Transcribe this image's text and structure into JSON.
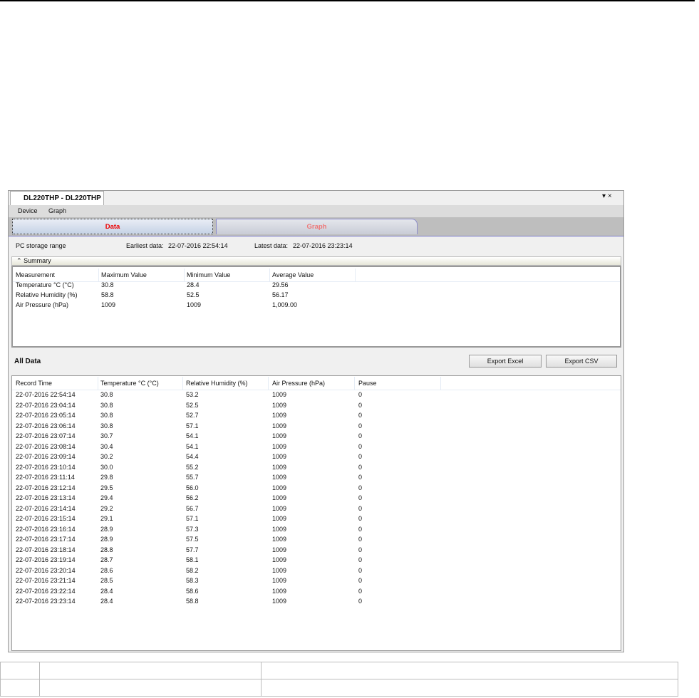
{
  "window": {
    "title": "DL220THP - DL220THP",
    "controls": [
      "▾",
      "×"
    ]
  },
  "menu": [
    "Device",
    "Graph"
  ],
  "tabs": [
    {
      "label": "Data",
      "active": true
    },
    {
      "label": "Graph",
      "active": false
    }
  ],
  "storage": {
    "label": "PC storage range",
    "earliest_label": "Earliest data:",
    "earliest": "22-07-2016 22:54:14",
    "latest_label": "Latest data:",
    "latest": "22-07-2016 23:23:14"
  },
  "summary": {
    "title": "Summary",
    "toggle_icon": "chevron-double-up",
    "columns": [
      "Measurement",
      "Maximum Value",
      "Minimum Value",
      "Average Value"
    ],
    "rows": [
      [
        "Temperature °C (°C)",
        "30.8",
        "28.4",
        "29.56"
      ],
      [
        "Relative Humidity (%)",
        "58.8",
        "52.5",
        "56.17"
      ],
      [
        "Air Pressure (hPa)",
        "1009",
        "1009",
        "1,009.00"
      ]
    ]
  },
  "all_data": {
    "title": "All Data",
    "export_excel": "Export Excel",
    "export_csv": "Export CSV",
    "columns": [
      "Record Time",
      "Temperature °C (°C)",
      "Relative Humidity (%)",
      "Air Pressure (hPa)",
      "Pause"
    ],
    "rows": [
      [
        "22-07-2016 22:54:14",
        "30.8",
        "53.2",
        "1009",
        "0"
      ],
      [
        "22-07-2016 23:04:14",
        "30.8",
        "52.5",
        "1009",
        "0"
      ],
      [
        "22-07-2016 23:05:14",
        "30.8",
        "52.7",
        "1009",
        "0"
      ],
      [
        "22-07-2016 23:06:14",
        "30.8",
        "57.1",
        "1009",
        "0"
      ],
      [
        "22-07-2016 23:07:14",
        "30.7",
        "54.1",
        "1009",
        "0"
      ],
      [
        "22-07-2016 23:08:14",
        "30.4",
        "54.1",
        "1009",
        "0"
      ],
      [
        "22-07-2016 23:09:14",
        "30.2",
        "54.4",
        "1009",
        "0"
      ],
      [
        "22-07-2016 23:10:14",
        "30.0",
        "55.2",
        "1009",
        "0"
      ],
      [
        "22-07-2016 23:11:14",
        "29.8",
        "55.7",
        "1009",
        "0"
      ],
      [
        "22-07-2016 23:12:14",
        "29.5",
        "56.0",
        "1009",
        "0"
      ],
      [
        "22-07-2016 23:13:14",
        "29.4",
        "56.2",
        "1009",
        "0"
      ],
      [
        "22-07-2016 23:14:14",
        "29.2",
        "56.7",
        "1009",
        "0"
      ],
      [
        "22-07-2016 23:15:14",
        "29.1",
        "57.1",
        "1009",
        "0"
      ],
      [
        "22-07-2016 23:16:14",
        "28.9",
        "57.3",
        "1009",
        "0"
      ],
      [
        "22-07-2016 23:17:14",
        "28.9",
        "57.5",
        "1009",
        "0"
      ],
      [
        "22-07-2016 23:18:14",
        "28.8",
        "57.7",
        "1009",
        "0"
      ],
      [
        "22-07-2016 23:19:14",
        "28.7",
        "58.1",
        "1009",
        "0"
      ],
      [
        "22-07-2016 23:20:14",
        "28.6",
        "58.2",
        "1009",
        "0"
      ],
      [
        "22-07-2016 23:21:14",
        "28.5",
        "58.3",
        "1009",
        "0"
      ],
      [
        "22-07-2016 23:22:14",
        "28.4",
        "58.6",
        "1009",
        "0"
      ],
      [
        "22-07-2016 23:23:14",
        "28.4",
        "58.8",
        "1009",
        "0"
      ]
    ]
  },
  "colors": {
    "active_tab_text": "#e00000",
    "inactive_tab_text": "#ee7777",
    "tab_border": "#7b7bc8"
  }
}
